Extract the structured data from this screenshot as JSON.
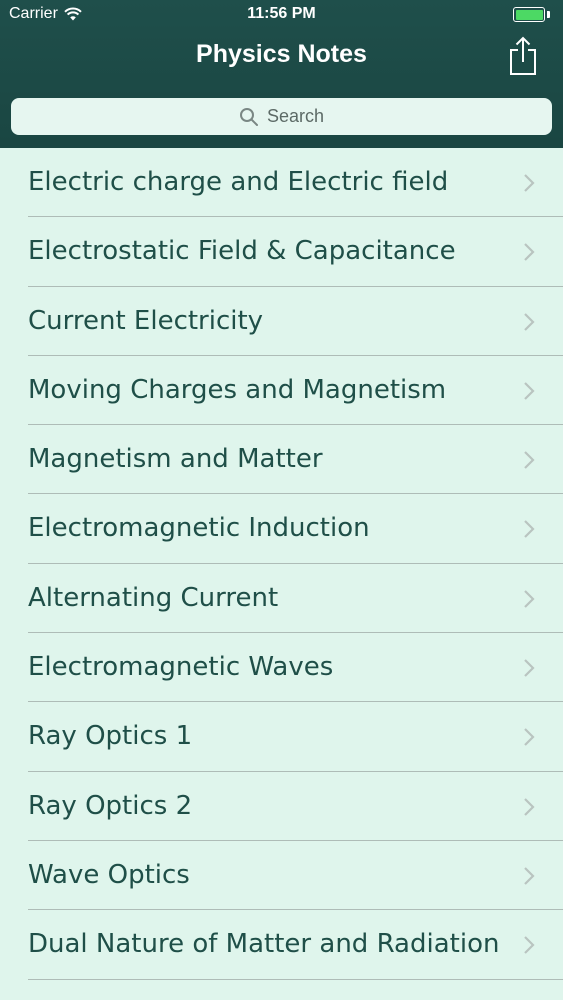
{
  "status_bar": {
    "carrier": "Carrier",
    "time": "11:56 PM",
    "battery_color": "#4cd964"
  },
  "nav": {
    "title": "Physics Notes",
    "share_icon": "share-icon"
  },
  "search": {
    "placeholder": "Search",
    "icon": "search-icon"
  },
  "colors": {
    "header_bg": "#1f4f4b",
    "list_bg": "#dff5ec",
    "row_text": "#1f4f48"
  },
  "items": [
    {
      "label": "Electric charge and Electric field"
    },
    {
      "label": "Electrostatic Field & Capacitance"
    },
    {
      "label": "Current Electricity"
    },
    {
      "label": "Moving Charges and Magnetism"
    },
    {
      "label": "Magnetism and Matter"
    },
    {
      "label": "Electromagnetic Induction"
    },
    {
      "label": "Alternating Current"
    },
    {
      "label": "Electromagnetic Waves"
    },
    {
      "label": "Ray Optics 1"
    },
    {
      "label": "Ray Optics 2"
    },
    {
      "label": "Wave Optics"
    },
    {
      "label": "Dual Nature of Matter and Radiation"
    }
  ]
}
